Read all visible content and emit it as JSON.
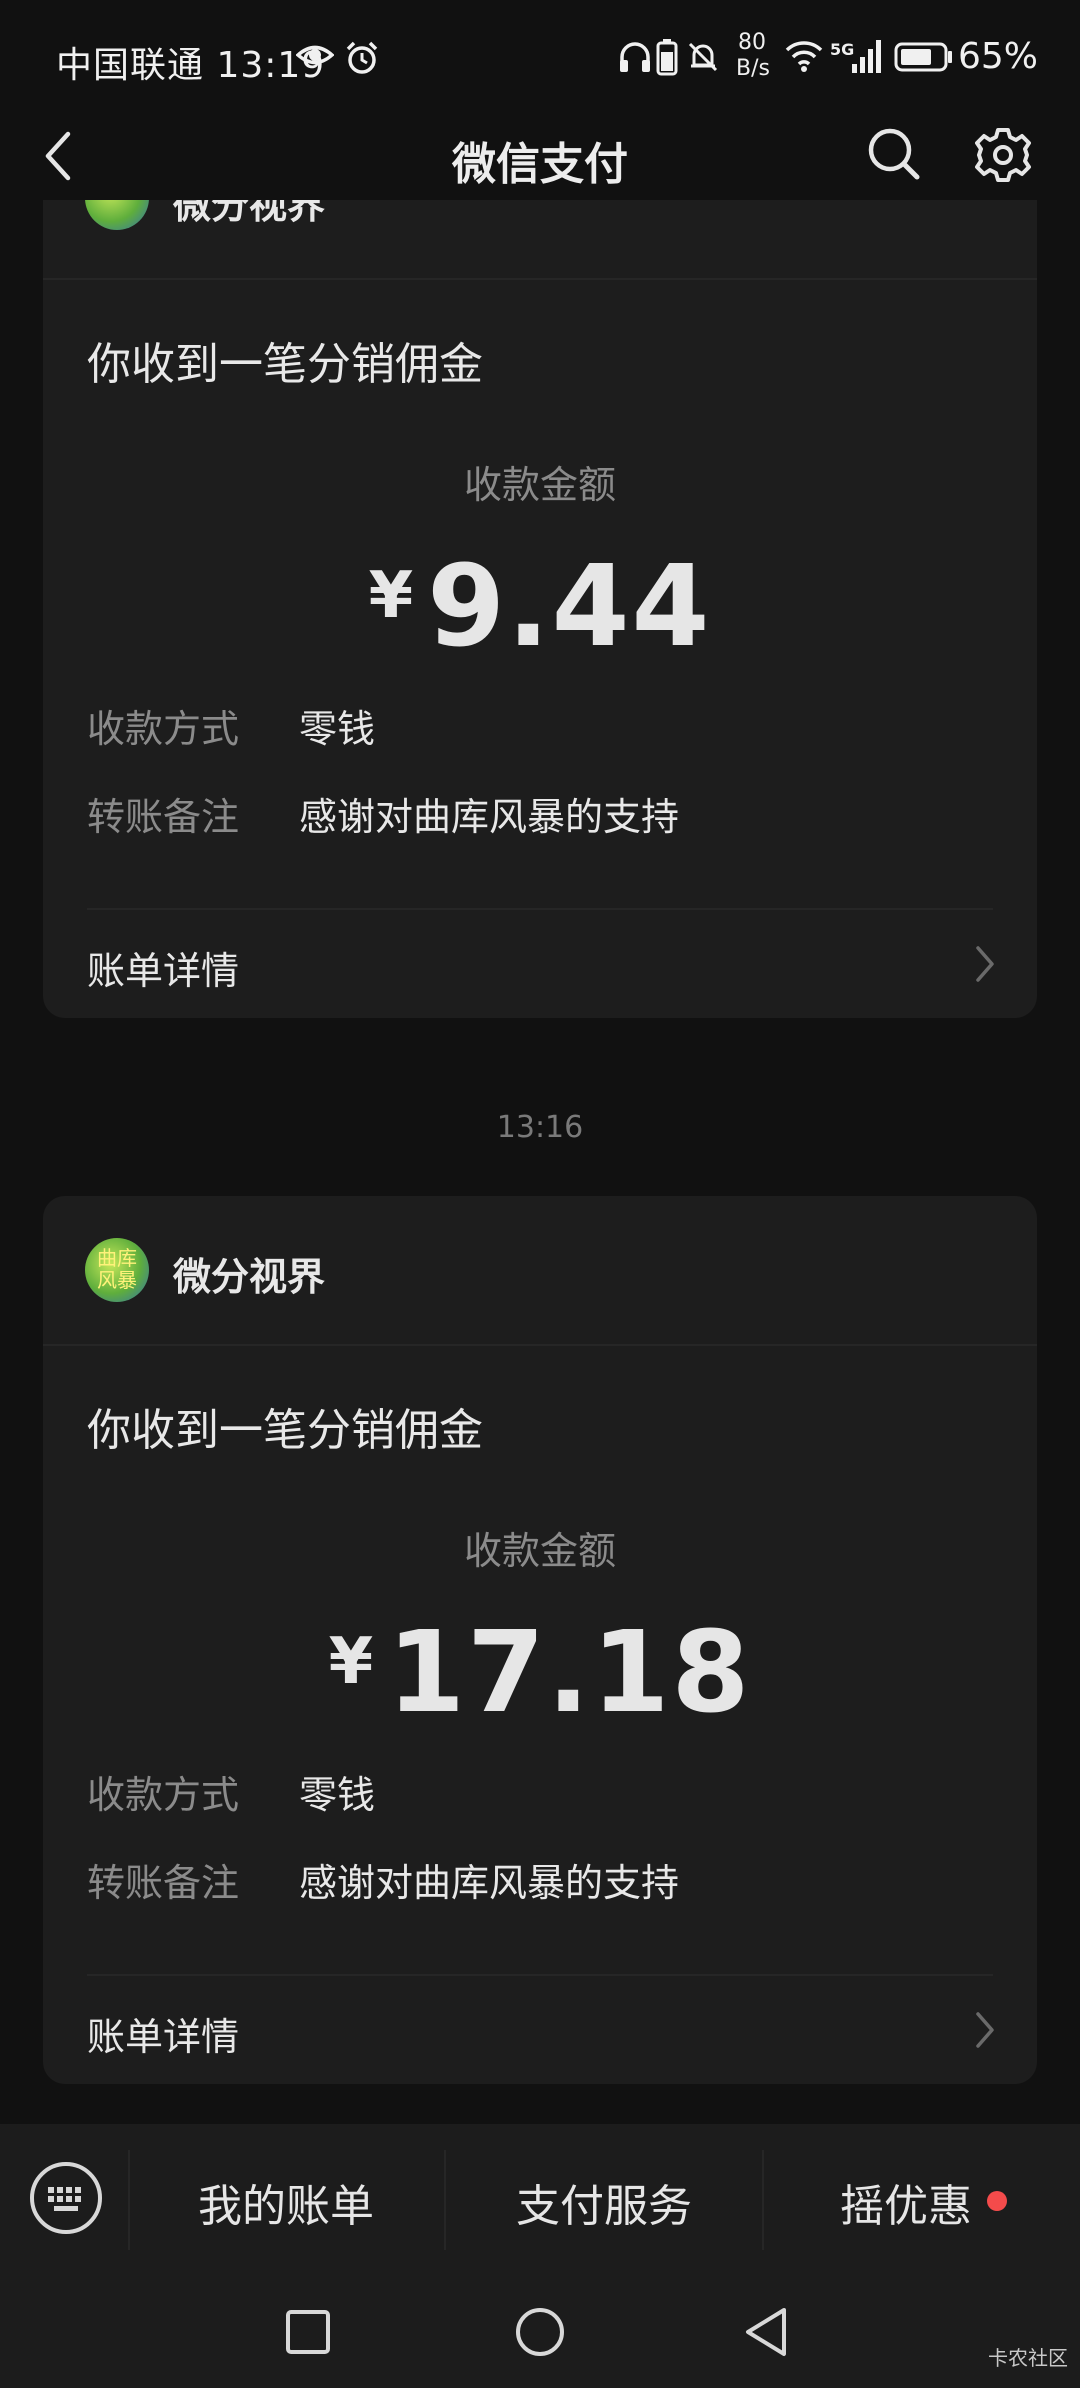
{
  "status_bar": {
    "carrier_time": "中国联通 13:19",
    "net_speed_value": "80",
    "net_speed_unit": "B/s",
    "network_type": "5G",
    "battery_percent": "65%"
  },
  "nav": {
    "title": "微信支付"
  },
  "cards": [
    {
      "sender": "微分视界",
      "headline": "你收到一笔分销佣金",
      "amount_label": "收款金额",
      "currency_symbol": "¥",
      "amount": "9.44",
      "rows": [
        {
          "label": "收款方式",
          "value": "零钱"
        },
        {
          "label": "转账备注",
          "value": "感谢对曲库风暴的支持"
        }
      ],
      "detail_link": "账单详情"
    },
    {
      "timestamp": "13:16",
      "sender": "微分视界",
      "avatar_text": "曲库风暴",
      "headline": "你收到一笔分销佣金",
      "amount_label": "收款金额",
      "currency_symbol": "¥",
      "amount": "17.18",
      "rows": [
        {
          "label": "收款方式",
          "value": "零钱"
        },
        {
          "label": "转账备注",
          "value": "感谢对曲库风暴的支持"
        }
      ],
      "detail_link": "账单详情"
    }
  ],
  "bottom_menu": {
    "items": [
      "我的账单",
      "支付服务",
      "摇优惠"
    ]
  },
  "watermark": "卡农社区",
  "colors": {
    "background": "#111111",
    "card": "#1d1d1d",
    "red_dot": "#f44b4b",
    "muted_text": "#8b8b8b"
  }
}
